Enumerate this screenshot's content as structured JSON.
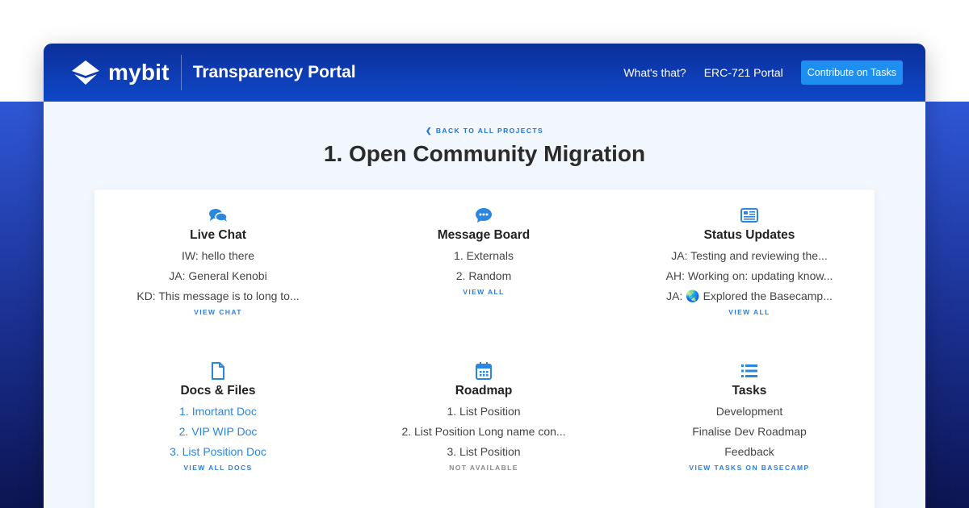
{
  "header": {
    "logo_text": "mybit",
    "portal_title": "Transparency Portal",
    "nav": [
      "What's that?",
      "ERC-721 Portal"
    ],
    "cta_label": "Contribute on Tasks"
  },
  "page": {
    "back_label": "BACK TO ALL PROJECTS",
    "title": "1. Open Community Migration"
  },
  "sections": [
    {
      "icon": "comments-icon",
      "title": "Live Chat",
      "lines": [
        "IW: hello there",
        "JA: General Kenobi",
        "KD: This message is to long to..."
      ],
      "action": "VIEW CHAT"
    },
    {
      "icon": "message-bubble-icon",
      "title": "Message Board",
      "lines": [
        "1. Externals",
        "2. Random"
      ],
      "action": "VIEW ALL"
    },
    {
      "icon": "newspaper-icon",
      "title": "Status Updates",
      "lines": [
        "JA: Testing and reviewing the...",
        "AH: Working on: updating know...",
        "JA: 🌏 Explored the Basecamp..."
      ],
      "action": "VIEW ALL"
    },
    {
      "icon": "file-icon",
      "title": "Docs & Files",
      "lines": [
        "1. Imortant Doc",
        "2. VIP WIP Doc",
        "3. List Position Doc"
      ],
      "action": "VIEW ALL DOCS"
    },
    {
      "icon": "calendar-icon",
      "title": "Roadmap",
      "lines": [
        "1. List Position",
        "2. List Position Long name con...",
        "3. List Position"
      ],
      "action": "NOT AVAILABLE"
    },
    {
      "icon": "list-icon",
      "title": "Tasks",
      "lines": [
        "Development",
        "Finalise Dev Roadmap",
        "Feedback"
      ],
      "action": "VIEW TASKS ON BASECAMP"
    }
  ],
  "colors": {
    "header_dark": "#0b2f9a",
    "header_light": "#0f48c9",
    "accent": "#2b86dd",
    "cta": "#1e8ff0",
    "page_bg": "#f1f7fd"
  }
}
